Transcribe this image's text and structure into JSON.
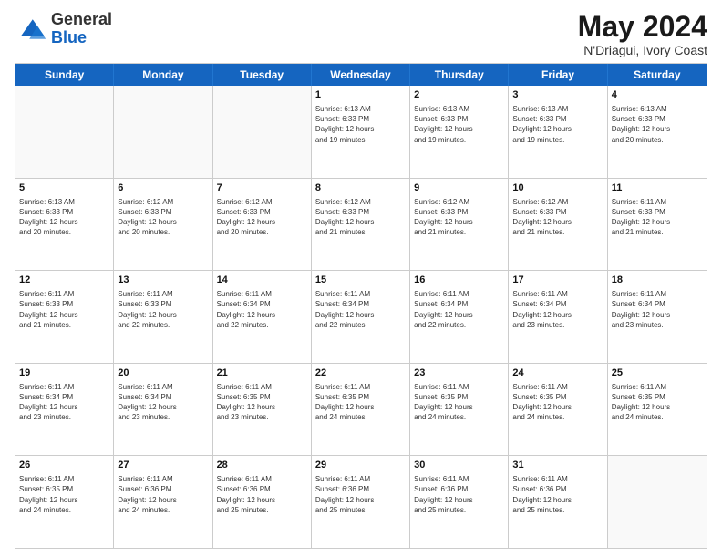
{
  "header": {
    "logo_general": "General",
    "logo_blue": "Blue",
    "title": "May 2024",
    "location": "N'Driagui, Ivory Coast"
  },
  "days_header": [
    "Sunday",
    "Monday",
    "Tuesday",
    "Wednesday",
    "Thursday",
    "Friday",
    "Saturday"
  ],
  "rows": [
    [
      {
        "day": "",
        "info": "",
        "empty": true
      },
      {
        "day": "",
        "info": "",
        "empty": true
      },
      {
        "day": "",
        "info": "",
        "empty": true
      },
      {
        "day": "1",
        "info": "Sunrise: 6:13 AM\nSunset: 6:33 PM\nDaylight: 12 hours\nand 19 minutes.",
        "empty": false
      },
      {
        "day": "2",
        "info": "Sunrise: 6:13 AM\nSunset: 6:33 PM\nDaylight: 12 hours\nand 19 minutes.",
        "empty": false
      },
      {
        "day": "3",
        "info": "Sunrise: 6:13 AM\nSunset: 6:33 PM\nDaylight: 12 hours\nand 19 minutes.",
        "empty": false
      },
      {
        "day": "4",
        "info": "Sunrise: 6:13 AM\nSunset: 6:33 PM\nDaylight: 12 hours\nand 20 minutes.",
        "empty": false
      }
    ],
    [
      {
        "day": "5",
        "info": "Sunrise: 6:13 AM\nSunset: 6:33 PM\nDaylight: 12 hours\nand 20 minutes.",
        "empty": false
      },
      {
        "day": "6",
        "info": "Sunrise: 6:12 AM\nSunset: 6:33 PM\nDaylight: 12 hours\nand 20 minutes.",
        "empty": false
      },
      {
        "day": "7",
        "info": "Sunrise: 6:12 AM\nSunset: 6:33 PM\nDaylight: 12 hours\nand 20 minutes.",
        "empty": false
      },
      {
        "day": "8",
        "info": "Sunrise: 6:12 AM\nSunset: 6:33 PM\nDaylight: 12 hours\nand 21 minutes.",
        "empty": false
      },
      {
        "day": "9",
        "info": "Sunrise: 6:12 AM\nSunset: 6:33 PM\nDaylight: 12 hours\nand 21 minutes.",
        "empty": false
      },
      {
        "day": "10",
        "info": "Sunrise: 6:12 AM\nSunset: 6:33 PM\nDaylight: 12 hours\nand 21 minutes.",
        "empty": false
      },
      {
        "day": "11",
        "info": "Sunrise: 6:11 AM\nSunset: 6:33 PM\nDaylight: 12 hours\nand 21 minutes.",
        "empty": false
      }
    ],
    [
      {
        "day": "12",
        "info": "Sunrise: 6:11 AM\nSunset: 6:33 PM\nDaylight: 12 hours\nand 21 minutes.",
        "empty": false
      },
      {
        "day": "13",
        "info": "Sunrise: 6:11 AM\nSunset: 6:33 PM\nDaylight: 12 hours\nand 22 minutes.",
        "empty": false
      },
      {
        "day": "14",
        "info": "Sunrise: 6:11 AM\nSunset: 6:34 PM\nDaylight: 12 hours\nand 22 minutes.",
        "empty": false
      },
      {
        "day": "15",
        "info": "Sunrise: 6:11 AM\nSunset: 6:34 PM\nDaylight: 12 hours\nand 22 minutes.",
        "empty": false
      },
      {
        "day": "16",
        "info": "Sunrise: 6:11 AM\nSunset: 6:34 PM\nDaylight: 12 hours\nand 22 minutes.",
        "empty": false
      },
      {
        "day": "17",
        "info": "Sunrise: 6:11 AM\nSunset: 6:34 PM\nDaylight: 12 hours\nand 23 minutes.",
        "empty": false
      },
      {
        "day": "18",
        "info": "Sunrise: 6:11 AM\nSunset: 6:34 PM\nDaylight: 12 hours\nand 23 minutes.",
        "empty": false
      }
    ],
    [
      {
        "day": "19",
        "info": "Sunrise: 6:11 AM\nSunset: 6:34 PM\nDaylight: 12 hours\nand 23 minutes.",
        "empty": false
      },
      {
        "day": "20",
        "info": "Sunrise: 6:11 AM\nSunset: 6:34 PM\nDaylight: 12 hours\nand 23 minutes.",
        "empty": false
      },
      {
        "day": "21",
        "info": "Sunrise: 6:11 AM\nSunset: 6:35 PM\nDaylight: 12 hours\nand 23 minutes.",
        "empty": false
      },
      {
        "day": "22",
        "info": "Sunrise: 6:11 AM\nSunset: 6:35 PM\nDaylight: 12 hours\nand 24 minutes.",
        "empty": false
      },
      {
        "day": "23",
        "info": "Sunrise: 6:11 AM\nSunset: 6:35 PM\nDaylight: 12 hours\nand 24 minutes.",
        "empty": false
      },
      {
        "day": "24",
        "info": "Sunrise: 6:11 AM\nSunset: 6:35 PM\nDaylight: 12 hours\nand 24 minutes.",
        "empty": false
      },
      {
        "day": "25",
        "info": "Sunrise: 6:11 AM\nSunset: 6:35 PM\nDaylight: 12 hours\nand 24 minutes.",
        "empty": false
      }
    ],
    [
      {
        "day": "26",
        "info": "Sunrise: 6:11 AM\nSunset: 6:35 PM\nDaylight: 12 hours\nand 24 minutes.",
        "empty": false
      },
      {
        "day": "27",
        "info": "Sunrise: 6:11 AM\nSunset: 6:36 PM\nDaylight: 12 hours\nand 24 minutes.",
        "empty": false
      },
      {
        "day": "28",
        "info": "Sunrise: 6:11 AM\nSunset: 6:36 PM\nDaylight: 12 hours\nand 25 minutes.",
        "empty": false
      },
      {
        "day": "29",
        "info": "Sunrise: 6:11 AM\nSunset: 6:36 PM\nDaylight: 12 hours\nand 25 minutes.",
        "empty": false
      },
      {
        "day": "30",
        "info": "Sunrise: 6:11 AM\nSunset: 6:36 PM\nDaylight: 12 hours\nand 25 minutes.",
        "empty": false
      },
      {
        "day": "31",
        "info": "Sunrise: 6:11 AM\nSunset: 6:36 PM\nDaylight: 12 hours\nand 25 minutes.",
        "empty": false
      },
      {
        "day": "",
        "info": "",
        "empty": true
      }
    ]
  ]
}
